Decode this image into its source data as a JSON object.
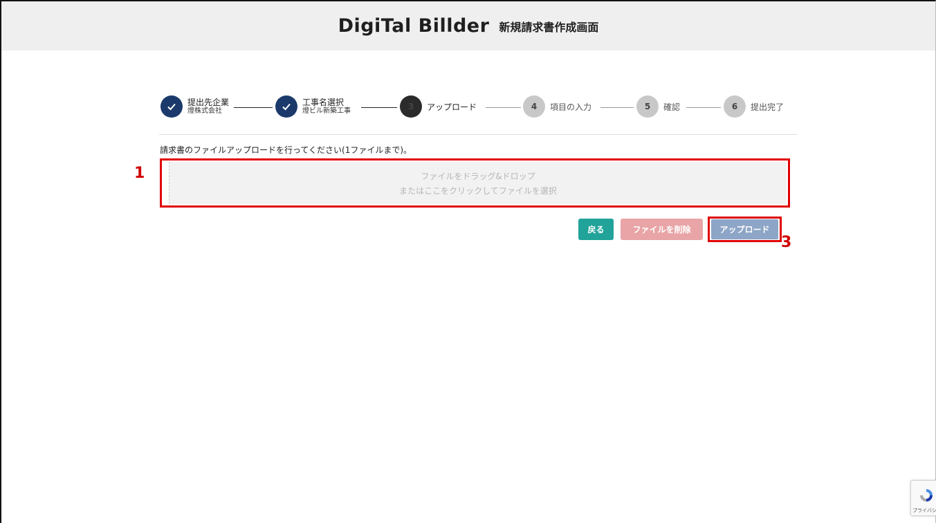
{
  "header": {
    "logo": "DigiTal Billder",
    "title": "新規請求書作成画面"
  },
  "steps": [
    {
      "label": "提出先企業",
      "sub": "燈株式会社",
      "state": "done",
      "icon": "check-icon"
    },
    {
      "label": "工事名選択",
      "sub": "燈ビル新築工事",
      "state": "done",
      "icon": "check-icon"
    },
    {
      "number": "3",
      "label": "アップロード",
      "state": "active"
    },
    {
      "number": "4",
      "label": "項目の入力",
      "state": "todo"
    },
    {
      "number": "5",
      "label": "確認",
      "state": "todo"
    },
    {
      "number": "6",
      "label": "提出完了",
      "state": "todo"
    }
  ],
  "upload": {
    "instruction": "請求書のファイルアップロードを行ってください(1ファイルまで)。",
    "dropzone_line1": "ファイルをドラッグ&ドロップ",
    "dropzone_line2": "またはここをクリックしてファイルを選択"
  },
  "buttons": {
    "back": "戻る",
    "delete": "ファイルを削除",
    "upload": "アップロード"
  },
  "callouts": {
    "one": "1",
    "three": "3"
  },
  "recaptcha": {
    "text": "プライバシー・利用規約"
  },
  "colors": {
    "step_done": "#1b3a6b",
    "back_button": "#22a39a",
    "delete_button": "#e8a4a6",
    "upload_button": "#8da5c6",
    "callout_red": "#e00000"
  }
}
